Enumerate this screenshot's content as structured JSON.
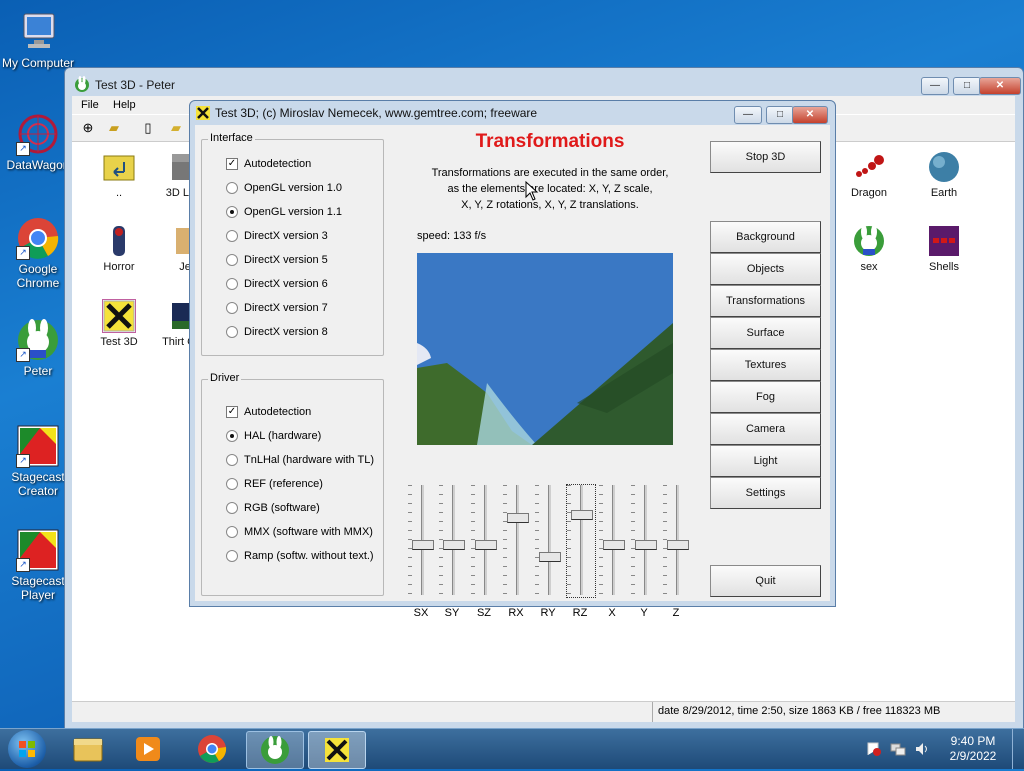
{
  "desktop": {
    "icons": [
      {
        "label": "My Computer"
      },
      {
        "label": "DataWagon"
      },
      {
        "label": "Google Chrome"
      },
      {
        "label": "Peter"
      },
      {
        "label": "Stagecast Creator"
      },
      {
        "label": "Stagecast Player"
      }
    ]
  },
  "explorer": {
    "title": "Test 3D - Peter",
    "menu": [
      "File",
      "Help"
    ],
    "files": [
      {
        "label": ".."
      },
      {
        "label": "3D Lum"
      },
      {
        "label": "Horror"
      },
      {
        "label": "Je"
      },
      {
        "label": "Test 3D"
      },
      {
        "label": "Thirt Gho"
      },
      {
        "label": "Dragon"
      },
      {
        "label": "Earth"
      },
      {
        "label": "sex"
      },
      {
        "label": "Shells"
      }
    ],
    "status": "date 8/29/2012, time 2:50, size 1863 KB / free 118323 MB"
  },
  "dialog": {
    "title": "Test 3D;  (c) Miroslav Nemecek, www.gemtree.com;  freeware",
    "heading": "Transformations",
    "description_line1": "Transformations are executed in the same order,",
    "description_line2": "as the elements are located: X, Y, Z scale,",
    "description_line3": "X, Y, Z rotations, X, Y, Z translations.",
    "speed": "speed: 133 f/s",
    "interface_group": "Interface",
    "interface_options": [
      {
        "label": "Autodetection",
        "type": "check",
        "checked": true
      },
      {
        "label": "OpenGL version 1.0",
        "type": "radio",
        "checked": false
      },
      {
        "label": "OpenGL version 1.1",
        "type": "radio",
        "checked": true
      },
      {
        "label": "DirectX version 3",
        "type": "radio",
        "checked": false
      },
      {
        "label": "DirectX version 5",
        "type": "radio",
        "checked": false
      },
      {
        "label": "DirectX version 6",
        "type": "radio",
        "checked": false
      },
      {
        "label": "DirectX version 7",
        "type": "radio",
        "checked": false
      },
      {
        "label": "DirectX version 8",
        "type": "radio",
        "checked": false
      }
    ],
    "driver_group": "Driver",
    "driver_options": [
      {
        "label": "Autodetection",
        "type": "check",
        "checked": true
      },
      {
        "label": "HAL (hardware)",
        "type": "radio",
        "checked": true
      },
      {
        "label": "TnLHal (hardware with TL)",
        "type": "radio",
        "checked": false
      },
      {
        "label": "REF (reference)",
        "type": "radio",
        "checked": false
      },
      {
        "label": "RGB (software)",
        "type": "radio",
        "checked": false
      },
      {
        "label": "MMX (software with MMX)",
        "type": "radio",
        "checked": false
      },
      {
        "label": "Ramp (softw. without text.)",
        "type": "radio",
        "checked": false
      }
    ],
    "buttons": {
      "stop": "Stop 3D",
      "background": "Background",
      "objects": "Objects",
      "transformations": "Transformations",
      "surface": "Surface",
      "textures": "Textures",
      "fog": "Fog",
      "camera": "Camera",
      "light": "Light",
      "settings": "Settings",
      "quit": "Quit"
    },
    "sliders": [
      {
        "label": "SX",
        "level": 0.5
      },
      {
        "label": "SY",
        "level": 0.5
      },
      {
        "label": "SZ",
        "level": 0.5
      },
      {
        "label": "RX",
        "level": 0.73
      },
      {
        "label": "RY",
        "level": 0.38
      },
      {
        "label": "RZ",
        "level": 0.78
      },
      {
        "label": "X",
        "level": 0.5
      },
      {
        "label": "Y",
        "level": 0.5
      },
      {
        "label": "Z",
        "level": 0.5
      }
    ]
  },
  "taskbar": {
    "time": "9:40 PM",
    "date": "2/9/2022"
  },
  "colors": {
    "heading": "#e01a1a",
    "sky": "#3a78c4",
    "terrain": "#2f5a2e"
  }
}
